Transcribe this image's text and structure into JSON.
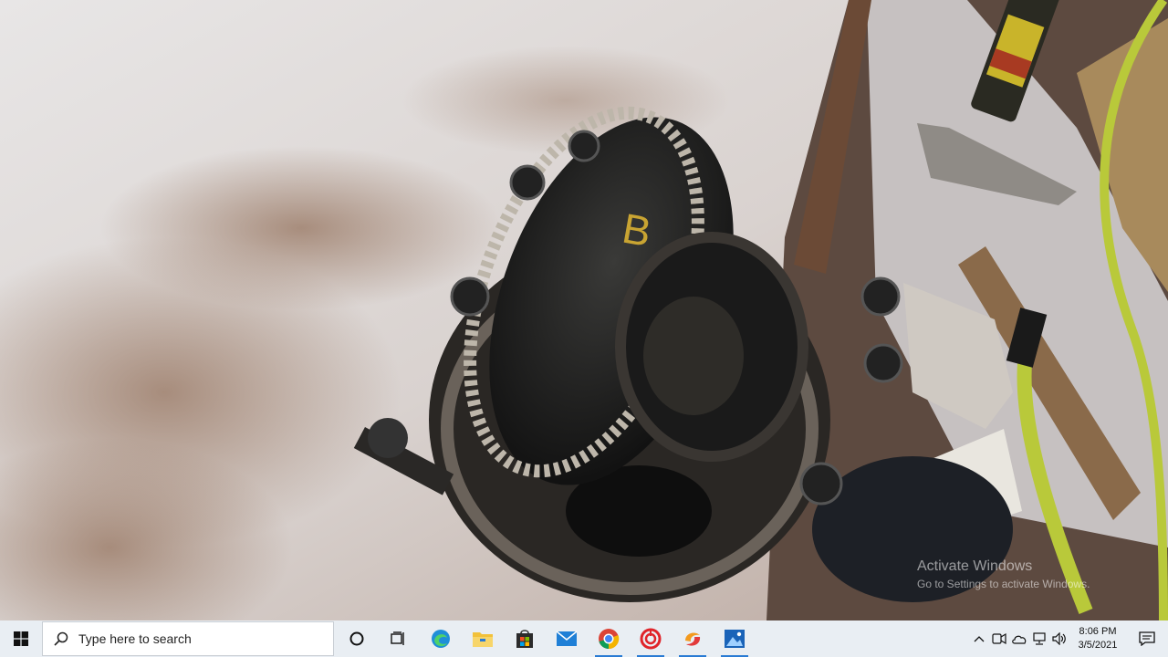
{
  "watermark": {
    "title": "Activate Windows",
    "subtitle": "Go to Settings to activate Windows."
  },
  "taskbar": {
    "search_placeholder": "Type here to search",
    "pinned": [
      {
        "name": "cortana",
        "icon": "circle-icon",
        "running": false
      },
      {
        "name": "task-view",
        "icon": "task-view-icon",
        "running": false
      },
      {
        "name": "edge",
        "icon": "edge-icon",
        "running": false
      },
      {
        "name": "file-explorer",
        "icon": "folder-icon",
        "running": false
      },
      {
        "name": "store",
        "icon": "store-bag-icon",
        "running": false
      },
      {
        "name": "mail",
        "icon": "mail-icon",
        "running": false
      },
      {
        "name": "chrome",
        "icon": "chrome-icon",
        "running": true
      },
      {
        "name": "app-red",
        "icon": "red-ring-icon",
        "running": true
      },
      {
        "name": "app-swirl",
        "icon": "swirl-icon",
        "running": true
      },
      {
        "name": "photos",
        "icon": "photos-icon",
        "running": true
      }
    ],
    "tray_icons": [
      "chevron-up-icon",
      "meet-icon",
      "onedrive-icon",
      "network-icon",
      "volume-icon"
    ],
    "time": "8:06 PM",
    "date": "3/5/2021",
    "accent": "#2a7bd4"
  }
}
